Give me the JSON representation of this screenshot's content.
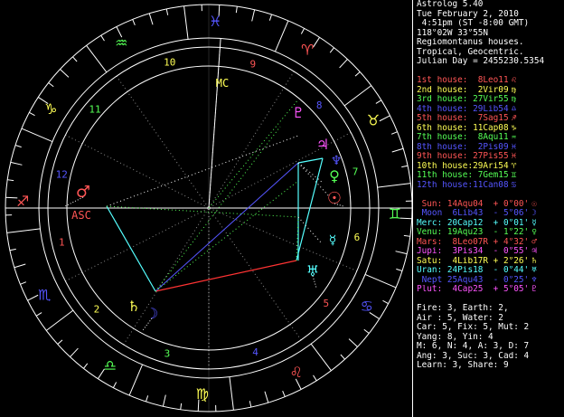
{
  "header": {
    "title": "Astrolog 5.40",
    "date": "Tue February 2, 2010",
    "time": " 4:51pm (ST -8:00 GMT)",
    "location": "118°02W 33°55N",
    "house_system": "Regiomontanus houses.",
    "zodiac": "Tropical, Geocentric.",
    "julian_day": "Julian Day = 2455230.5354"
  },
  "houses": [
    {
      "label": "1st house:",
      "value": " 8Leo11",
      "color": "#ff5555",
      "glyph": "♌"
    },
    {
      "label": "2nd house:",
      "value": " 2Vir09",
      "color": "#ffff55",
      "glyph": "♍"
    },
    {
      "label": "3rd house:",
      "value": "27Vir55",
      "color": "#55ff55",
      "glyph": "♍"
    },
    {
      "label": "4th house:",
      "value": "29Lib54",
      "color": "#5555ff",
      "glyph": "♎"
    },
    {
      "label": "5th house:",
      "value": " 7Sag15",
      "color": "#ff5555",
      "glyph": "♐"
    },
    {
      "label": "6th house:",
      "value": "11Cap08",
      "color": "#ffff55",
      "glyph": "♑"
    },
    {
      "label": "7th house:",
      "value": " 8Aqu11",
      "color": "#55ff55",
      "glyph": "♒"
    },
    {
      "label": "8th house:",
      "value": " 2Pis09",
      "color": "#5555ff",
      "glyph": "♓"
    },
    {
      "label": "9th house:",
      "value": "27Pis55",
      "color": "#ff5555",
      "glyph": "♓"
    },
    {
      "label": "10th house:",
      "value": "29Ari54",
      "color": "#ffff55",
      "glyph": "♈"
    },
    {
      "label": "11th house:",
      "value": " 7Gem15",
      "color": "#55ff55",
      "glyph": "♊"
    },
    {
      "label": "12th house:",
      "value": "11Can08",
      "color": "#5555ff",
      "glyph": "♋"
    }
  ],
  "planets": [
    {
      "name": "Sun:",
      "pos": "14Aqu04",
      "retro": " ",
      "lat": "+ 0°00'",
      "color": "#ff5555",
      "glyph": "☉"
    },
    {
      "name": "Moon",
      "pos": " 6Lib43",
      "retro": " ",
      "lat": "- 5°06'",
      "color": "#5555ff",
      "glyph": "☽"
    },
    {
      "name": "Merc:",
      "pos": "20Cap12",
      "retro": " ",
      "lat": "+ 0°01'",
      "color": "#55ffff",
      "glyph": "☿"
    },
    {
      "name": "Venu:",
      "pos": "19Aqu23",
      "retro": " ",
      "lat": "- 1°22'",
      "color": "#55ff55",
      "glyph": "♀"
    },
    {
      "name": "Mars:",
      "pos": " 8Leo07",
      "retro": "R",
      "lat": "+ 4°32'",
      "color": "#ff5555",
      "glyph": "♂"
    },
    {
      "name": "Jupi:",
      "pos": " 3Pis34",
      "retro": " ",
      "lat": "- 0°55'",
      "color": "#ff55ff",
      "glyph": "♃"
    },
    {
      "name": "Satu:",
      "pos": " 4Lib17",
      "retro": "R",
      "lat": "+ 2°26'",
      "color": "#ffff55",
      "glyph": "♄"
    },
    {
      "name": "Uran:",
      "pos": "24Pis18",
      "retro": " ",
      "lat": "- 0°44'",
      "color": "#55ffff",
      "glyph": "♅"
    },
    {
      "name": "Nept",
      "pos": "25Aqu43",
      "retro": " ",
      "lat": "- 0°25'",
      "color": "#5555ff",
      "glyph": "♆"
    },
    {
      "name": "Plut:",
      "pos": " 4Cap25",
      "retro": " ",
      "lat": "+ 5°05'",
      "color": "#ff55ff",
      "glyph": "♇"
    }
  ],
  "stats": [
    "Fire: 3, Earth: 2,",
    "Air : 5, Water: 2",
    "Car: 5, Fix: 5, Mut: 2",
    "Yang: 8, Yin: 4",
    "M: 6, N: 4, A: 3, D: 7",
    "Ang: 3, Suc: 3, Cad: 4",
    "Learn: 3, Share: 9"
  ],
  "wheel": {
    "angles": [
      {
        "text": "ASC",
        "color": "#ff5555",
        "at": "asc"
      },
      {
        "text": "MC",
        "color": "#ffff55",
        "at": "mc"
      }
    ],
    "zodiac_signs": [
      {
        "glyph": "♈",
        "color": "#ff5555"
      },
      {
        "glyph": "♉",
        "color": "#ffff55"
      },
      {
        "glyph": "♊",
        "color": "#55ff55"
      },
      {
        "glyph": "♋",
        "color": "#5555ff"
      },
      {
        "glyph": "♌",
        "color": "#ff5555"
      },
      {
        "glyph": "♍",
        "color": "#ffff55"
      },
      {
        "glyph": "♎",
        "color": "#55ff55"
      },
      {
        "glyph": "♏",
        "color": "#5555ff"
      },
      {
        "glyph": "♐",
        "color": "#ff5555"
      },
      {
        "glyph": "♑",
        "color": "#ffff55"
      },
      {
        "glyph": "♒",
        "color": "#55ff55"
      },
      {
        "glyph": "♓",
        "color": "#5555ff"
      }
    ],
    "house_numbers": [
      {
        "text": "1",
        "color": "#ff5555"
      },
      {
        "text": "2",
        "color": "#ffff55"
      },
      {
        "text": "3",
        "color": "#55ff55"
      },
      {
        "text": "4",
        "color": "#5555ff"
      },
      {
        "text": "5",
        "color": "#ff5555"
      },
      {
        "text": "6",
        "color": "#ffff55"
      },
      {
        "text": "7",
        "color": "#55ff55"
      },
      {
        "text": "8",
        "color": "#5555ff"
      },
      {
        "text": "9",
        "color": "#ff5555"
      },
      {
        "text": "10",
        "color": "#ffff55"
      },
      {
        "text": "11",
        "color": "#55ff55"
      },
      {
        "text": "12",
        "color": "#5555ff"
      }
    ]
  }
}
